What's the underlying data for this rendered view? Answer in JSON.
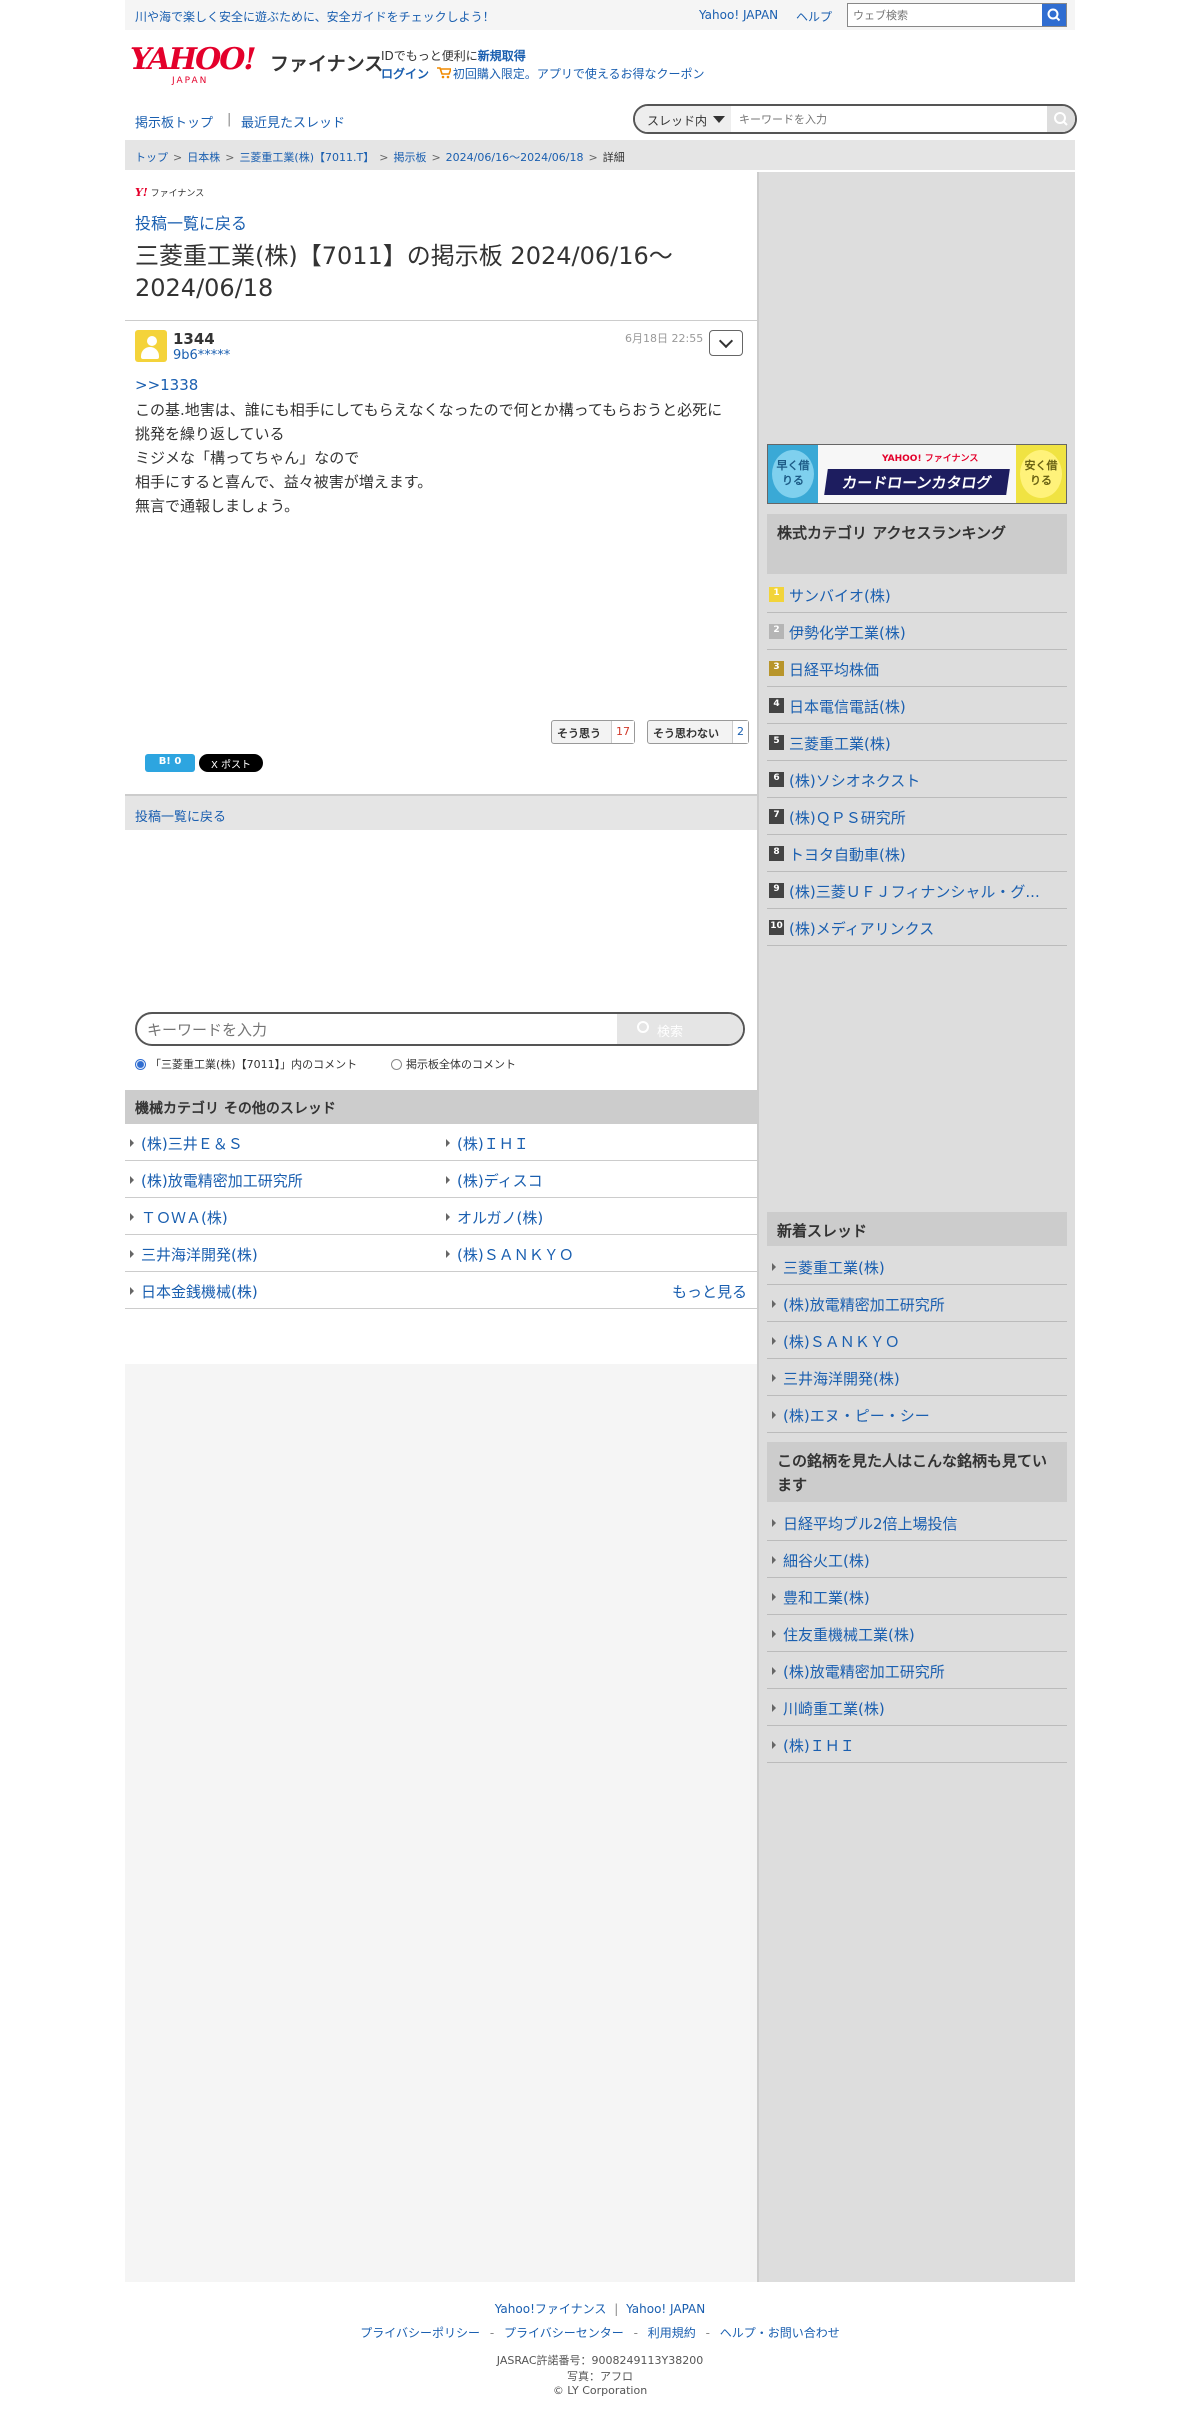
{
  "topbar": {
    "notice": "川や海で楽しく安全に遊ぶために、安全ガイドをチェックしよう！",
    "links": [
      "Yahoo! JAPAN",
      "ヘルプ"
    ],
    "search_placeholder": "ウェブ検索"
  },
  "header": {
    "logo_text": "YAHOO!",
    "logo_sub": "JAPAN",
    "logo_service": "ファイナンス",
    "promo_prefix": "IDでもっと便利に",
    "promo_link": "新規取得",
    "login": "ログイン",
    "coupon": "初回購入限定。アプリで使えるお得なクーポン"
  },
  "nav": {
    "board_top": "掲示板トップ",
    "separator": "|",
    "recent": "最近見たスレッド",
    "scope": "スレッド内",
    "search_placeholder": "キーワードを入力"
  },
  "breadcrumb": [
    "トップ",
    "日本株",
    "三菱重工業(株)【7011.T】",
    "掲示板",
    "2024/06/16〜2024/06/18",
    "詳細"
  ],
  "breadcrumb_sep": ">",
  "thread": {
    "mini_logo": "Y!",
    "mini_logo_service": "ファイナンス",
    "back_link": "投稿一覧に戻る",
    "title": "三菱重工業(株)【7011】の掲示板 2024/06/16〜2024/06/18"
  },
  "post": {
    "number": "1344",
    "user_id": "9b6*****",
    "date": "6月18日 22:55",
    "reply_to": ">>1338",
    "lines": [
      "この基.地害は、誰にも相手にしてもらえなくなったので何とか構ってもらおうと必死に挑発を繰り返している",
      "ミジメな「構ってちゃん」なので",
      "相手にすると喜んで、益々被害が増えます。",
      "無言で通報しましょう。"
    ],
    "agree_label": "そう思う",
    "agree_count": "17",
    "disagree_label": "そう思わない",
    "disagree_count": "2",
    "hatena": "B! 0",
    "x_post": "X ポスト"
  },
  "back_bar": "投稿一覧に戻る",
  "keyword_search": {
    "placeholder": "キーワードを入力",
    "button": "検索",
    "radio_thread": "「三菱重工業(株)【7011】」内のコメント",
    "radio_all": "掲示板全体のコメント"
  },
  "category": {
    "heading": "機械カテゴリ その他のスレッド",
    "items": [
      "(株)三井Ｅ＆Ｓ",
      "(株)ＩＨＩ",
      "(株)放電精密加工研究所",
      "(株)ディスコ",
      "ＴＯＷＡ(株)",
      "オルガノ(株)",
      "三井海洋開発(株)",
      "(株)ＳＡＮＫＹＯ",
      "日本金銭機械(株)"
    ],
    "more": "もっと見る"
  },
  "sidebar": {
    "ad_left": "早く借りる",
    "ad_right": "安く借りる",
    "ad_sub": "YAHOO! ファイナンス",
    "ad_title": "カードローンカタログ",
    "ranking_heading": "株式カテゴリ アクセスランキング",
    "ranking": [
      {
        "rank": "1",
        "name": "サンバイオ(株)"
      },
      {
        "rank": "2",
        "name": "伊勢化学工業(株)"
      },
      {
        "rank": "3",
        "name": "日経平均株価"
      },
      {
        "rank": "4",
        "name": "日本電信電話(株)"
      },
      {
        "rank": "5",
        "name": "三菱重工業(株)"
      },
      {
        "rank": "6",
        "name": "(株)ソシオネクスト"
      },
      {
        "rank": "7",
        "name": "(株)ＱＰＳ研究所"
      },
      {
        "rank": "8",
        "name": "トヨタ自動車(株)"
      },
      {
        "rank": "9",
        "name": "(株)三菱ＵＦＪフィナンシャル・グ..."
      },
      {
        "rank": "10",
        "name": "(株)メディアリンクス"
      }
    ],
    "rank_colors": [
      "#f2d43a",
      "#b5b5b5",
      "#b8952b"
    ],
    "new_heading": "新着スレッド",
    "new_threads": [
      "三菱重工業(株)",
      "(株)放電精密加工研究所",
      "(株)ＳＡＮＫＹＯ",
      "三井海洋開発(株)",
      "(株)エヌ・ピー・シー"
    ],
    "also_heading": "この銘柄を見た人はこんな銘柄も見ています",
    "also": [
      "日経平均ブル2倍上場投信",
      "細谷火工(株)",
      "豊和工業(株)",
      "住友重機械工業(株)",
      "(株)放電精密加工研究所",
      "川崎重工業(株)",
      "(株)ＩＨＩ"
    ]
  },
  "footer": {
    "links1": [
      "Yahoo!ファイナンス",
      "|",
      "Yahoo! JAPAN"
    ],
    "links2": [
      "プライバシーポリシー",
      "-",
      "プライバシーセンター",
      "-",
      "利用規約",
      "-",
      "ヘルプ・お問い合わせ"
    ],
    "jasrac": "JASRAC許諾番号：9008249113Y38200",
    "photo": "写真：アフロ",
    "copyright": "© LY Corporation"
  }
}
